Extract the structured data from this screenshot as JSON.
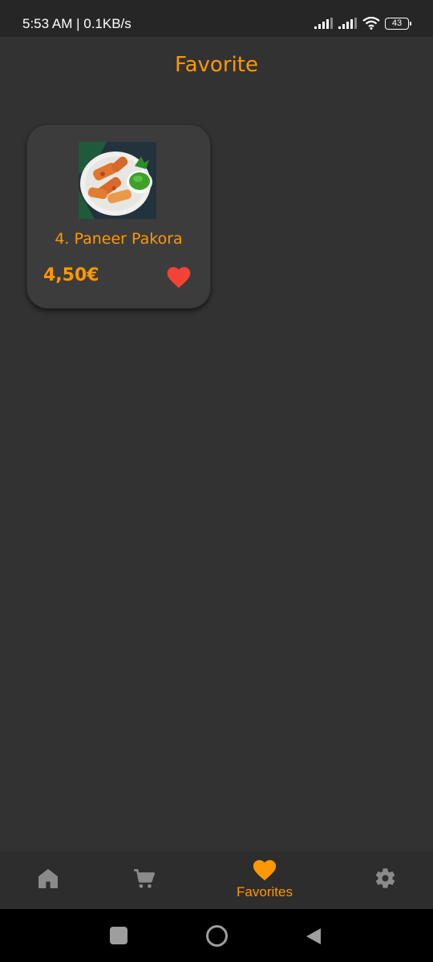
{
  "status_bar": {
    "time": "5:53 AM | 0.1KB/s",
    "battery": "43"
  },
  "page": {
    "title": "Favorite"
  },
  "favorites": [
    {
      "name": "4. Paneer Pakora",
      "price": "4,50€",
      "image_icon": "paneer-pakora-photo",
      "favorited": true
    }
  ],
  "bottom_nav": {
    "items": [
      {
        "icon": "home-icon",
        "label": ""
      },
      {
        "icon": "cart-icon",
        "label": ""
      },
      {
        "icon": "heart-icon",
        "label": "Favorites",
        "active": true
      },
      {
        "icon": "gear-icon",
        "label": ""
      }
    ]
  },
  "colors": {
    "accent": "#ff9800",
    "heart": "#f44336",
    "background": "#323232",
    "card": "#3c3c3c",
    "inactive_icon": "#8a8a8a"
  }
}
